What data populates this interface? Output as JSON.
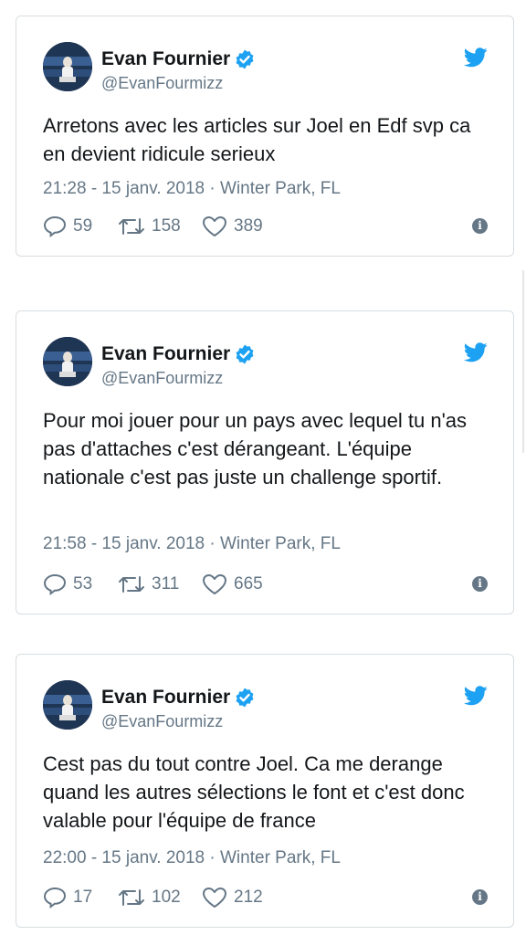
{
  "colors": {
    "accent": "#1da1f2",
    "secondary_text": "#657786",
    "border": "#d8dde1"
  },
  "icons": {
    "verified": "verified-badge-icon",
    "bird": "twitter-bird-icon",
    "reply": "reply-icon",
    "retweet": "retweet-icon",
    "like": "heart-icon",
    "info": "info-icon"
  },
  "tweets": [
    {
      "author": "Evan Fournier",
      "handle": "@EvanFourmizz",
      "text": "Arretons avec les articles sur Joel en Edf svp ca en devient ridicule serieux",
      "meta": "21:28 - 15 janv. 2018 · Winter Park, FL",
      "replies": "59",
      "retweets": "158",
      "likes": "389"
    },
    {
      "author": "Evan Fournier",
      "handle": "@EvanFourmizz",
      "text": "Pour moi jouer pour un pays avec lequel tu n'as pas d'attaches c'est dérangeant. L'équipe nationale c'est pas juste un challenge sportif.",
      "meta": "21:58 - 15 janv. 2018 · Winter Park, FL",
      "replies": "53",
      "retweets": "311",
      "likes": "665"
    },
    {
      "author": "Evan Fournier",
      "handle": "@EvanFourmizz",
      "text": "Cest pas du tout contre Joel. Ca me derange quand les autres sélections le font et c'est donc valable pour l'équipe de france",
      "meta": "22:00 - 15 janv. 2018 · Winter Park, FL",
      "replies": "17",
      "retweets": "102",
      "likes": "212"
    }
  ]
}
